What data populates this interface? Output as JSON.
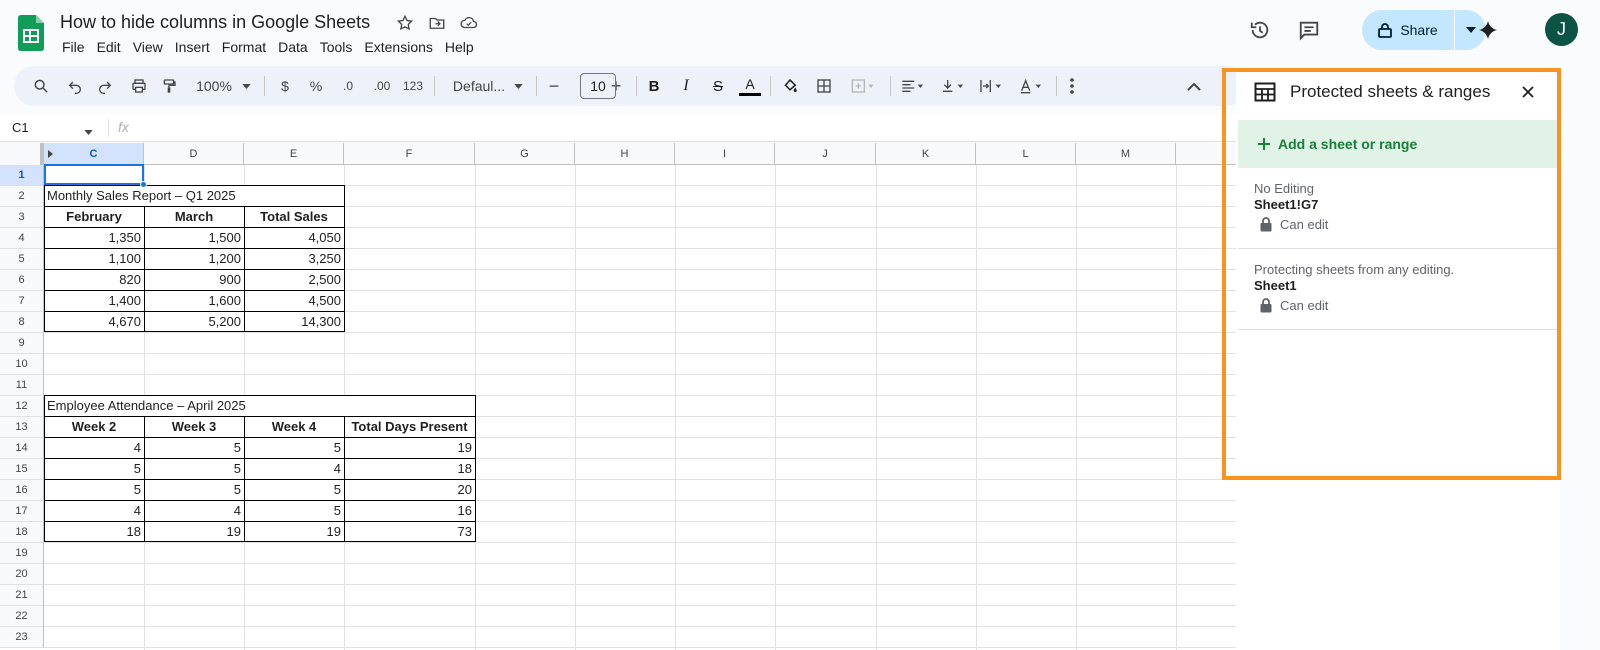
{
  "doc": {
    "title": "How to hide columns in Google Sheets",
    "menu": [
      "File",
      "Edit",
      "View",
      "Insert",
      "Format",
      "Data",
      "Tools",
      "Extensions",
      "Help"
    ]
  },
  "header": {
    "share_label": "Share",
    "avatar_initial": "J"
  },
  "toolbar": {
    "zoom": "100%",
    "currency": "$",
    "percent": "%",
    "dec_decrease": ".0",
    "dec_increase": ".00",
    "number_format": "123",
    "font": "Defaul...",
    "font_size": "10",
    "bold": "B",
    "italic": "I",
    "strike": "S",
    "text_color": "A",
    "minus": "−",
    "plus": "+"
  },
  "formula_bar": {
    "name_box": "C1",
    "fx": "fx"
  },
  "grid": {
    "columns": [
      "C",
      "D",
      "E",
      "F",
      "G",
      "H",
      "I",
      "J",
      "K",
      "L",
      "M"
    ],
    "rows": [
      "1",
      "2",
      "3",
      "4",
      "5",
      "6",
      "7",
      "8",
      "9",
      "10",
      "11",
      "12",
      "13",
      "14",
      "15",
      "16",
      "17",
      "18",
      "19",
      "20",
      "21",
      "22",
      "23"
    ],
    "selected_cell": "C1",
    "sales_table": {
      "title": "Monthly Sales Report – Q1 2025",
      "headers": [
        "February",
        "March",
        "Total Sales"
      ],
      "rows": [
        [
          "1,350",
          "1,500",
          "4,050"
        ],
        [
          "1,100",
          "1,200",
          "3,250"
        ],
        [
          "820",
          "900",
          "2,500"
        ],
        [
          "1,400",
          "1,600",
          "4,500"
        ],
        [
          "4,670",
          "5,200",
          "14,300"
        ]
      ]
    },
    "attendance_table": {
      "title": "Employee Attendance – April 2025",
      "headers": [
        "Week 2",
        "Week 3",
        "Week 4",
        "Total Days Present"
      ],
      "rows": [
        [
          "4",
          "5",
          "5",
          "19"
        ],
        [
          "5",
          "5",
          "4",
          "18"
        ],
        [
          "5",
          "5",
          "5",
          "20"
        ],
        [
          "4",
          "4",
          "5",
          "16"
        ],
        [
          "18",
          "19",
          "19",
          "73"
        ]
      ]
    }
  },
  "panel": {
    "title": "Protected sheets & ranges",
    "add_label": "Add a sheet or range",
    "items": [
      {
        "description": "No Editing",
        "range": "Sheet1!G7",
        "permission": "Can edit"
      },
      {
        "description": "Protecting sheets from any editing.",
        "range": "Sheet1",
        "permission": "Can edit"
      }
    ]
  },
  "colors": {
    "accent": "#1a73e8",
    "share_bg": "#c2e7ff",
    "highlight_outline": "#f7931e",
    "add_range_bg": "#e1f3e6",
    "add_range_text": "#188038"
  }
}
